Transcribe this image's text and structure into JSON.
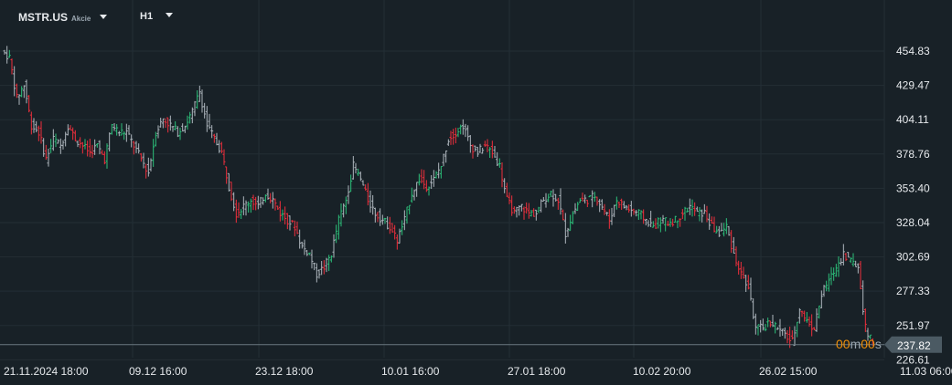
{
  "header": {
    "symbol": "MSTR.US",
    "type": "Akcie",
    "timeframe": "H1"
  },
  "countdown": {
    "min": "00",
    "m": "m",
    "sec": "00",
    "s": "s"
  },
  "colors": {
    "up": "#2cc07a",
    "down": "#ef2f3c",
    "neutral": "#aeb6bd",
    "bg": "#182127",
    "grid": "#232e35",
    "price_tag": "#4b5a63"
  },
  "chart_data": {
    "type": "ohlc",
    "title": "MSTR.US H1",
    "current_price": 237.82,
    "ylim": [
      226.61,
      470
    ],
    "yticks": [
      454.83,
      429.47,
      404.11,
      378.76,
      353.4,
      328.04,
      302.69,
      277.33,
      251.97,
      226.61
    ],
    "ytick_labels": [
      "454.83",
      "429.47",
      "404.11",
      "378.76",
      "353.40",
      "328.04",
      "302.69",
      "277.33",
      "251.97",
      "226.61"
    ],
    "xtick_labels": [
      "21.11.2024  18:00",
      "09.12  16:00",
      "23.12  18:00",
      "10.01  16:00",
      "27.01  18:00",
      "10.02  20:00",
      "26.02  15:00",
      "11.03  06:00"
    ],
    "closes": [
      450,
      420,
      430,
      400,
      395,
      375,
      390,
      385,
      400,
      390,
      385,
      380,
      385,
      375,
      400,
      395,
      395,
      385,
      375,
      365,
      395,
      405,
      400,
      395,
      400,
      410,
      425,
      400,
      390,
      380,
      355,
      335,
      340,
      345,
      340,
      350,
      345,
      335,
      330,
      325,
      310,
      305,
      290,
      295,
      305,
      330,
      345,
      370,
      360,
      345,
      335,
      330,
      325,
      315,
      330,
      350,
      360,
      355,
      360,
      370,
      390,
      395,
      400,
      385,
      380,
      385,
      380,
      370,
      345,
      335,
      340,
      335,
      335,
      345,
      350,
      345,
      320,
      335,
      345,
      345,
      348,
      340,
      330,
      345,
      340,
      337,
      335,
      330,
      325,
      330,
      328,
      330,
      335,
      340,
      335,
      335,
      325,
      320,
      325,
      305,
      290,
      280,
      250,
      250,
      255,
      250,
      245,
      240,
      265,
      255,
      250,
      275,
      285,
      295,
      305,
      300,
      295,
      250,
      238
    ]
  }
}
